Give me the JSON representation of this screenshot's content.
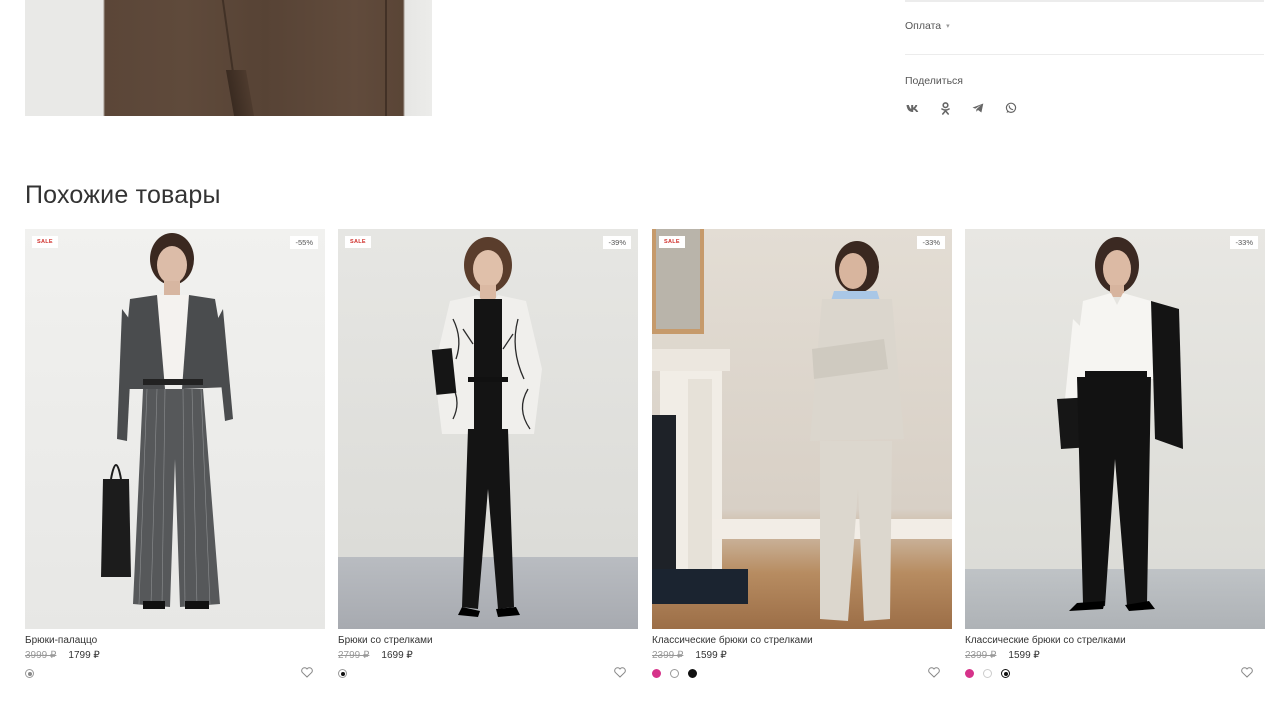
{
  "sidebar": {
    "payment_label": "Оплата",
    "share_label": "Поделиться",
    "socials": [
      "vk-icon",
      "odnoklassniki-icon",
      "telegram-icon",
      "whatsapp-icon"
    ]
  },
  "similar": {
    "title": "Похожие товары",
    "products": [
      {
        "name": "Брюки-палаццо",
        "old_price": "3999 ₽",
        "new_price": "1799 ₽",
        "sale_badge": "SALE",
        "discount": "-55%",
        "swatches": [
          "#8a8a8a"
        ],
        "selected": 0
      },
      {
        "name": "Брюки со стрелками",
        "old_price": "2799 ₽",
        "new_price": "1699 ₽",
        "sale_badge": "SALE",
        "discount": "-39%",
        "swatches": [
          "#111111"
        ],
        "selected": 0
      },
      {
        "name": "Классические брюки со стрелками",
        "old_price": "2399 ₽",
        "new_price": "1599 ₽",
        "sale_badge": "SALE",
        "discount": "-33%",
        "swatches": [
          "#d6338a",
          "#ffffff",
          "#111111"
        ],
        "selected": -1
      },
      {
        "name": "Классические брюки со стрелками",
        "old_price": "2399 ₽",
        "new_price": "1599 ₽",
        "sale_badge": "",
        "discount": "-33%",
        "swatches": [
          "#d6338a",
          "#ffffff",
          "#111111"
        ],
        "selected": 2
      }
    ]
  },
  "colors": {
    "sale_red": "#d0312d",
    "accent_pink": "#d6338a"
  }
}
